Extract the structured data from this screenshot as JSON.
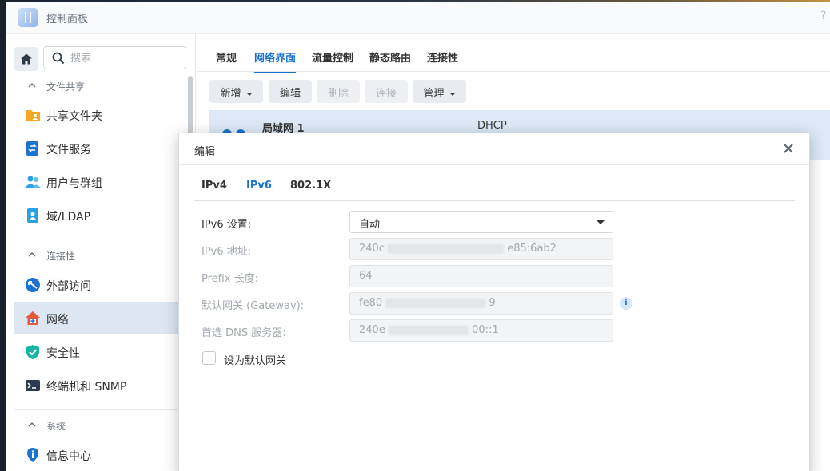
{
  "window": {
    "title": "控制面板",
    "help": "?"
  },
  "sidebar": {
    "search_placeholder": "搜索",
    "sections": [
      {
        "label": "文件共享",
        "items": [
          {
            "label": "共享文件夹",
            "icon": "folder-share-icon",
            "color": "#f5a623"
          },
          {
            "label": "文件服务",
            "icon": "file-services-icon",
            "color": "#1a73cf"
          },
          {
            "label": "用户与群组",
            "icon": "users-icon",
            "color": "#2aa1e3"
          },
          {
            "label": "域/LDAP",
            "icon": "ldap-icon",
            "color": "#2aa1e3"
          }
        ]
      },
      {
        "label": "连接性",
        "items": [
          {
            "label": "外部访问",
            "icon": "external-access-icon",
            "color": "#1a73cf"
          },
          {
            "label": "网络",
            "icon": "network-home-icon",
            "color": "#e55a3c",
            "active": true
          },
          {
            "label": "安全性",
            "icon": "shield-icon",
            "color": "#16b5a4"
          },
          {
            "label": "终端机和 SNMP",
            "icon": "terminal-icon",
            "color": "#2b3a4e"
          }
        ]
      },
      {
        "label": "系统",
        "items": [
          {
            "label": "信息中心",
            "icon": "info-center-icon",
            "color": "#1a73cf"
          }
        ]
      }
    ]
  },
  "main": {
    "tabs": [
      "常规",
      "网络界面",
      "流量控制",
      "静态路由",
      "连接性"
    ],
    "active_tab": "网络界面",
    "toolbar": {
      "new_label": "新增",
      "edit_label": "编辑",
      "delete_label": "删除",
      "connect_label": "连接",
      "manage_label": "管理"
    },
    "interface": {
      "name": "局域网 1",
      "mode": "DHCP"
    }
  },
  "dialog": {
    "title": "编辑",
    "tabs": [
      "IPv4",
      "IPv6",
      "802.1X"
    ],
    "active_tab": "IPv6",
    "fields": {
      "ipv6_setting_label": "IPv6 设置:",
      "ipv6_setting_value": "自动",
      "ipv6_address_label": "IPv6 地址:",
      "ipv6_address_prefix": "240c",
      "ipv6_address_suffix": "e85:6ab2",
      "prefix_length_label": "Prefix 长度:",
      "prefix_length_value": "64",
      "gateway_label": "默认网关 (Gateway):",
      "gateway_prefix": "fe80",
      "gateway_suffix": "9",
      "dns_label": "首选 DNS 服务器:",
      "dns_prefix": "240e",
      "dns_suffix": "00::1"
    },
    "default_gateway_checkbox": "设为默认网关"
  },
  "colors": {
    "accent": "#1a73cf",
    "active_row": "#dde6f3"
  }
}
